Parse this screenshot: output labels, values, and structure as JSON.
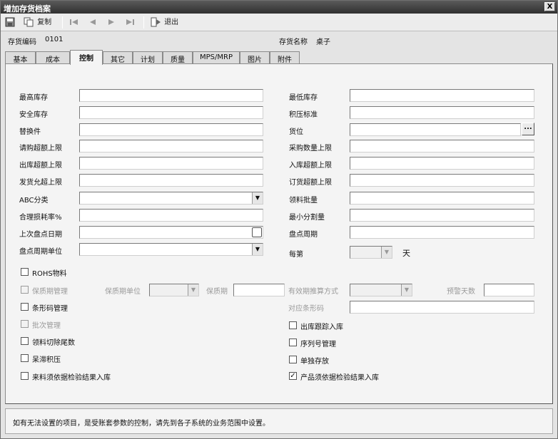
{
  "window": {
    "title": "增加存货档案",
    "close_label": "X"
  },
  "toolbar": {
    "save_icon": "save-icon",
    "copy_label": "复制",
    "exit_label": "退出",
    "nav_icons": [
      "first-record-icon",
      "prev-record-icon",
      "next-record-icon",
      "last-record-icon"
    ]
  },
  "header": {
    "code_label": "存货编码",
    "code_value": "0101",
    "name_label": "存货名称",
    "name_value": "桌子"
  },
  "tabs": [
    "基本",
    "成本",
    "控制",
    "其它",
    "计划",
    "质量",
    "MPS/MRP",
    "图片",
    "附件"
  ],
  "active_tab": "控制",
  "left_fields": [
    {
      "label": "最高库存",
      "value": ""
    },
    {
      "label": "安全库存",
      "value": ""
    },
    {
      "label": "替换件",
      "value": ""
    },
    {
      "label": "请购超额上限",
      "value": ""
    },
    {
      "label": "出库超额上限",
      "value": ""
    },
    {
      "label": "发货允超上限",
      "value": ""
    },
    {
      "label": "ABC分类",
      "value": ""
    },
    {
      "label": "合理损耗率%",
      "value": ""
    },
    {
      "label": "上次盘点日期",
      "value": ""
    },
    {
      "label": "盘点周期单位",
      "value": ""
    }
  ],
  "right_fields": [
    {
      "label": "最低库存",
      "value": ""
    },
    {
      "label": "积压标准",
      "value": ""
    },
    {
      "label": "货位",
      "value": ""
    },
    {
      "label": "采购数量上限",
      "value": ""
    },
    {
      "label": "入库超额上限",
      "value": ""
    },
    {
      "label": "订货超额上限",
      "value": ""
    },
    {
      "label": "领料批量",
      "value": ""
    },
    {
      "label": "最小分割量",
      "value": ""
    },
    {
      "label": "盘点周期",
      "value": ""
    }
  ],
  "every_label": "每第",
  "day_label": "天",
  "checkboxes": {
    "rohs": {
      "label": "ROHS物料",
      "checked": false
    },
    "shelf_life": {
      "label": "保质期管理",
      "checked": false
    },
    "barcode": {
      "label": "条形码管理",
      "checked": false
    },
    "batch": {
      "label": "批次管理",
      "checked": false
    },
    "cut_tail": {
      "label": "领料切除尾数",
      "checked": false
    },
    "trace_backlog": {
      "label": "呆滞积压",
      "checked": false
    },
    "incoming_inspection": {
      "label": "来料须依据检验结果入库",
      "checked": false
    },
    "outbound_trace": {
      "label": "出库跟踪入库",
      "checked": false
    },
    "serial": {
      "label": "序列号管理",
      "checked": false
    },
    "single_cost": {
      "label": "单独存放",
      "checked": false
    },
    "product_inspection": {
      "label": "产品须依据检验结果入库",
      "checked": true
    }
  },
  "shelf_life_row": {
    "unit_label": "保质期单位",
    "period_label": "保质期",
    "calc_label": "有效期推算方式",
    "warn_days_label": "预警天数"
  },
  "barcode_label": "对应条形码",
  "status_text": "如有无法设置的项目，是受账套参数的控制，请先到各子系统的业务范围中设置。",
  "check_mark": "✓",
  "dropdown_arrow": "▼",
  "dots_label": "..."
}
